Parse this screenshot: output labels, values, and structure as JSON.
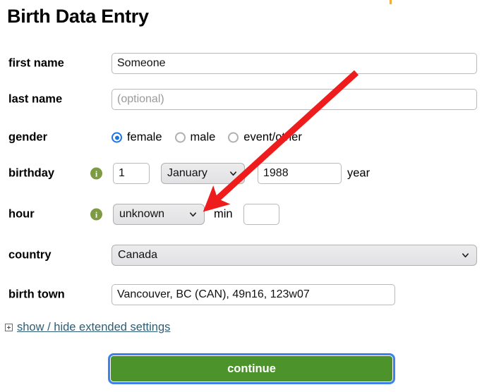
{
  "page": {
    "title": "Birth Data Entry"
  },
  "form": {
    "first_name": {
      "label": "first name",
      "value": "Someone",
      "placeholder": ""
    },
    "last_name": {
      "label": "last name",
      "value": "",
      "placeholder": "(optional)"
    },
    "gender": {
      "label": "gender",
      "options": [
        {
          "label": "female",
          "checked": true
        },
        {
          "label": "male",
          "checked": false
        },
        {
          "label": "event/other",
          "checked": false
        }
      ]
    },
    "birthday": {
      "label": "birthday",
      "info_icon": "info-icon",
      "day_value": "1",
      "day_placeholder": "",
      "month_value": "January",
      "year_value": "1988",
      "year_placeholder": "",
      "year_unit": "year"
    },
    "hour": {
      "label": "hour",
      "info_icon": "info-icon",
      "hour_value": "unknown",
      "min_unit": "min",
      "min_value": "",
      "min_placeholder": ""
    },
    "country": {
      "label": "country",
      "value": "Canada"
    },
    "birth_town": {
      "label": "birth town",
      "value": "Vancouver, BC (CAN), 49n16, 123w07",
      "placeholder": ""
    },
    "extended": {
      "expander_icon": "plus-box-icon",
      "link_label": "show / hide extended settings"
    },
    "submit": {
      "label": "continue"
    }
  },
  "annotation": {
    "arrow_color": "#ee1c1c",
    "arrow_name": "red-pointer-arrow"
  },
  "colors": {
    "accent_blue": "#1a73e8",
    "focus_blue": "#3b83e8",
    "button_green": "#4b932a",
    "info_green": "#7d9b43",
    "link_blue": "#2f5d74",
    "arrow_red": "#ee1c1c"
  }
}
